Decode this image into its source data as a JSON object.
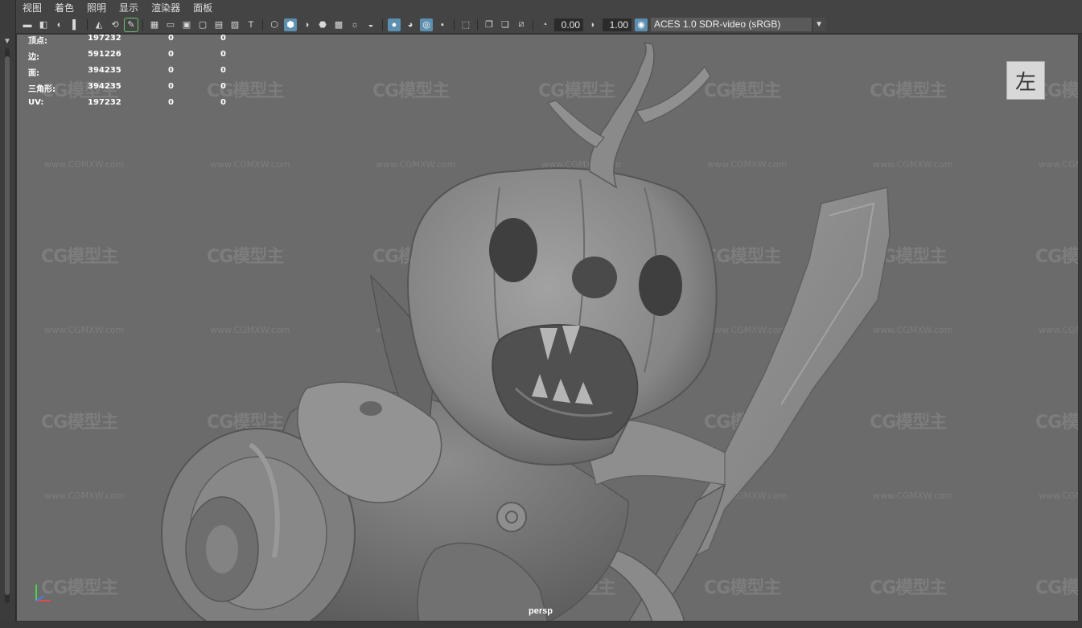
{
  "menu": [
    "视图",
    "着色",
    "照明",
    "显示",
    "渲染器",
    "面板"
  ],
  "toolbar": {
    "exposure": "0.00",
    "gamma": "1.00",
    "color_space": "ACES 1.0 SDR-video (sRGB)"
  },
  "hud": {
    "rows": [
      {
        "label": "顶点:",
        "v1": "197232",
        "v2": "0",
        "v3": "0"
      },
      {
        "label": "边:",
        "v1": "591226",
        "v2": "0",
        "v3": "0"
      },
      {
        "label": "面:",
        "v1": "394235",
        "v2": "0",
        "v3": "0"
      },
      {
        "label": "三角形:",
        "v1": "394235",
        "v2": "0",
        "v3": "0"
      },
      {
        "label": "UV:",
        "v1": "197232",
        "v2": "0",
        "v3": "0"
      }
    ]
  },
  "view_cube": "左",
  "camera": "persp",
  "watermark": {
    "brand": "CG模型主",
    "url": "www.CGMXW.com"
  },
  "colors": {
    "viewport": "#6b6b6b",
    "ui": "#444444",
    "active_icon": "#5d8fb0"
  }
}
